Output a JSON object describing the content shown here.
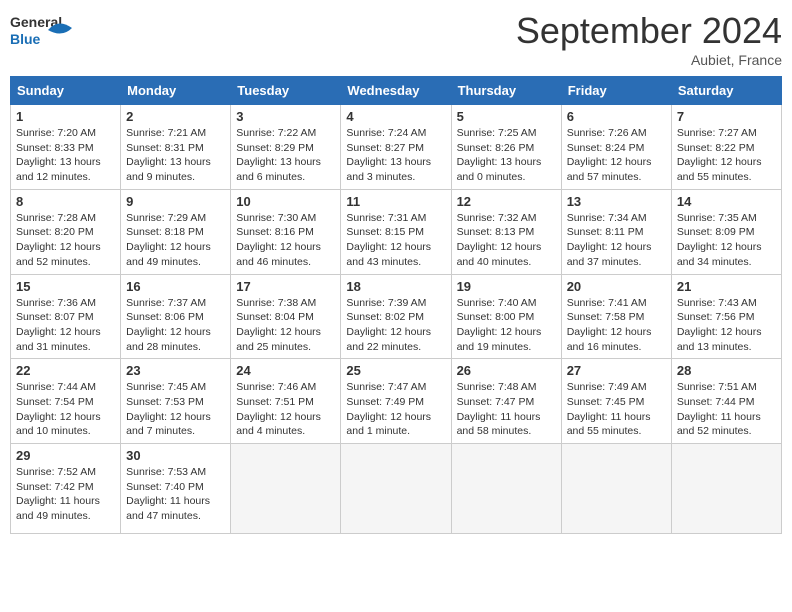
{
  "logo": {
    "text_general": "General",
    "text_blue": "Blue"
  },
  "header": {
    "month_year": "September 2024",
    "location": "Aubiet, France"
  },
  "weekdays": [
    "Sunday",
    "Monday",
    "Tuesday",
    "Wednesday",
    "Thursday",
    "Friday",
    "Saturday"
  ],
  "weeks": [
    [
      {
        "day": "1",
        "sunrise": "Sunrise: 7:20 AM",
        "sunset": "Sunset: 8:33 PM",
        "daylight": "Daylight: 13 hours and 12 minutes."
      },
      {
        "day": "2",
        "sunrise": "Sunrise: 7:21 AM",
        "sunset": "Sunset: 8:31 PM",
        "daylight": "Daylight: 13 hours and 9 minutes."
      },
      {
        "day": "3",
        "sunrise": "Sunrise: 7:22 AM",
        "sunset": "Sunset: 8:29 PM",
        "daylight": "Daylight: 13 hours and 6 minutes."
      },
      {
        "day": "4",
        "sunrise": "Sunrise: 7:24 AM",
        "sunset": "Sunset: 8:27 PM",
        "daylight": "Daylight: 13 hours and 3 minutes."
      },
      {
        "day": "5",
        "sunrise": "Sunrise: 7:25 AM",
        "sunset": "Sunset: 8:26 PM",
        "daylight": "Daylight: 13 hours and 0 minutes."
      },
      {
        "day": "6",
        "sunrise": "Sunrise: 7:26 AM",
        "sunset": "Sunset: 8:24 PM",
        "daylight": "Daylight: 12 hours and 57 minutes."
      },
      {
        "day": "7",
        "sunrise": "Sunrise: 7:27 AM",
        "sunset": "Sunset: 8:22 PM",
        "daylight": "Daylight: 12 hours and 55 minutes."
      }
    ],
    [
      {
        "day": "8",
        "sunrise": "Sunrise: 7:28 AM",
        "sunset": "Sunset: 8:20 PM",
        "daylight": "Daylight: 12 hours and 52 minutes."
      },
      {
        "day": "9",
        "sunrise": "Sunrise: 7:29 AM",
        "sunset": "Sunset: 8:18 PM",
        "daylight": "Daylight: 12 hours and 49 minutes."
      },
      {
        "day": "10",
        "sunrise": "Sunrise: 7:30 AM",
        "sunset": "Sunset: 8:16 PM",
        "daylight": "Daylight: 12 hours and 46 minutes."
      },
      {
        "day": "11",
        "sunrise": "Sunrise: 7:31 AM",
        "sunset": "Sunset: 8:15 PM",
        "daylight": "Daylight: 12 hours and 43 minutes."
      },
      {
        "day": "12",
        "sunrise": "Sunrise: 7:32 AM",
        "sunset": "Sunset: 8:13 PM",
        "daylight": "Daylight: 12 hours and 40 minutes."
      },
      {
        "day": "13",
        "sunrise": "Sunrise: 7:34 AM",
        "sunset": "Sunset: 8:11 PM",
        "daylight": "Daylight: 12 hours and 37 minutes."
      },
      {
        "day": "14",
        "sunrise": "Sunrise: 7:35 AM",
        "sunset": "Sunset: 8:09 PM",
        "daylight": "Daylight: 12 hours and 34 minutes."
      }
    ],
    [
      {
        "day": "15",
        "sunrise": "Sunrise: 7:36 AM",
        "sunset": "Sunset: 8:07 PM",
        "daylight": "Daylight: 12 hours and 31 minutes."
      },
      {
        "day": "16",
        "sunrise": "Sunrise: 7:37 AM",
        "sunset": "Sunset: 8:06 PM",
        "daylight": "Daylight: 12 hours and 28 minutes."
      },
      {
        "day": "17",
        "sunrise": "Sunrise: 7:38 AM",
        "sunset": "Sunset: 8:04 PM",
        "daylight": "Daylight: 12 hours and 25 minutes."
      },
      {
        "day": "18",
        "sunrise": "Sunrise: 7:39 AM",
        "sunset": "Sunset: 8:02 PM",
        "daylight": "Daylight: 12 hours and 22 minutes."
      },
      {
        "day": "19",
        "sunrise": "Sunrise: 7:40 AM",
        "sunset": "Sunset: 8:00 PM",
        "daylight": "Daylight: 12 hours and 19 minutes."
      },
      {
        "day": "20",
        "sunrise": "Sunrise: 7:41 AM",
        "sunset": "Sunset: 7:58 PM",
        "daylight": "Daylight: 12 hours and 16 minutes."
      },
      {
        "day": "21",
        "sunrise": "Sunrise: 7:43 AM",
        "sunset": "Sunset: 7:56 PM",
        "daylight": "Daylight: 12 hours and 13 minutes."
      }
    ],
    [
      {
        "day": "22",
        "sunrise": "Sunrise: 7:44 AM",
        "sunset": "Sunset: 7:54 PM",
        "daylight": "Daylight: 12 hours and 10 minutes."
      },
      {
        "day": "23",
        "sunrise": "Sunrise: 7:45 AM",
        "sunset": "Sunset: 7:53 PM",
        "daylight": "Daylight: 12 hours and 7 minutes."
      },
      {
        "day": "24",
        "sunrise": "Sunrise: 7:46 AM",
        "sunset": "Sunset: 7:51 PM",
        "daylight": "Daylight: 12 hours and 4 minutes."
      },
      {
        "day": "25",
        "sunrise": "Sunrise: 7:47 AM",
        "sunset": "Sunset: 7:49 PM",
        "daylight": "Daylight: 12 hours and 1 minute."
      },
      {
        "day": "26",
        "sunrise": "Sunrise: 7:48 AM",
        "sunset": "Sunset: 7:47 PM",
        "daylight": "Daylight: 11 hours and 58 minutes."
      },
      {
        "day": "27",
        "sunrise": "Sunrise: 7:49 AM",
        "sunset": "Sunset: 7:45 PM",
        "daylight": "Daylight: 11 hours and 55 minutes."
      },
      {
        "day": "28",
        "sunrise": "Sunrise: 7:51 AM",
        "sunset": "Sunset: 7:44 PM",
        "daylight": "Daylight: 11 hours and 52 minutes."
      }
    ],
    [
      {
        "day": "29",
        "sunrise": "Sunrise: 7:52 AM",
        "sunset": "Sunset: 7:42 PM",
        "daylight": "Daylight: 11 hours and 49 minutes."
      },
      {
        "day": "30",
        "sunrise": "Sunrise: 7:53 AM",
        "sunset": "Sunset: 7:40 PM",
        "daylight": "Daylight: 11 hours and 47 minutes."
      },
      null,
      null,
      null,
      null,
      null
    ]
  ]
}
